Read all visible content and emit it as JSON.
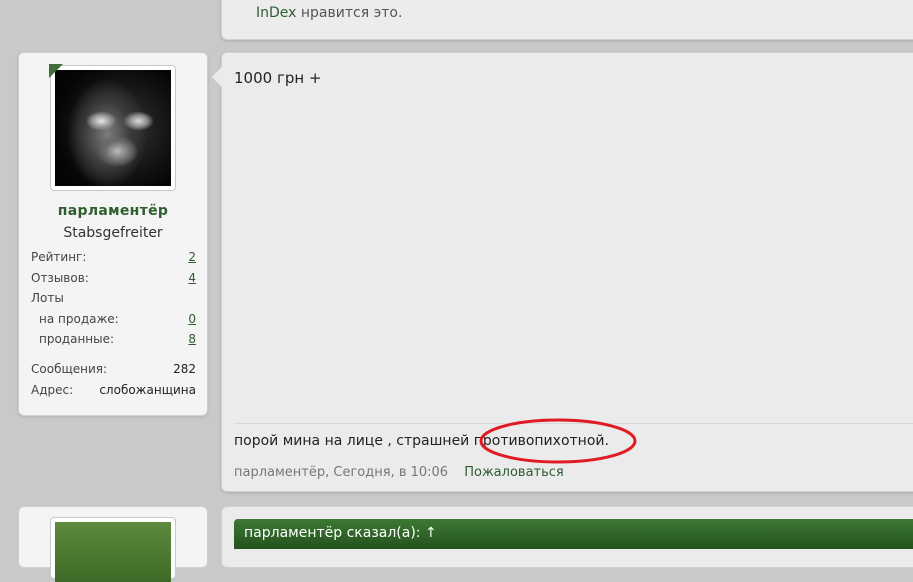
{
  "prev_post": {
    "liker": "InDex",
    "likes_suffix": "нравится это."
  },
  "user": {
    "name": "парламентёр",
    "title": "Stabsgefreiter",
    "stats": {
      "rating_label": "Рейтинг:",
      "rating_value": "2",
      "reviews_label": "Отзывов:",
      "reviews_value": "4",
      "lots_label": "Лоты",
      "selling_label": "на продаже:",
      "selling_value": "0",
      "sold_label": "проданные:",
      "sold_value": "8",
      "messages_label": "Сообщения:",
      "messages_value": "282",
      "address_label": "Адрес:",
      "address_value": "слобожанщина"
    }
  },
  "post": {
    "message": "1000 грн +",
    "signature": "порой мина на лице , страшней противопихотной.",
    "author": "парламентёр",
    "time": "Сегодня, в 10:06",
    "report_label": "Пожаловаться"
  },
  "next_post": {
    "quote_header": "парламентёр сказал(а): ↑"
  },
  "colors": {
    "accent_green": "#2e5d2e",
    "annotation_red": "#e01b24"
  }
}
